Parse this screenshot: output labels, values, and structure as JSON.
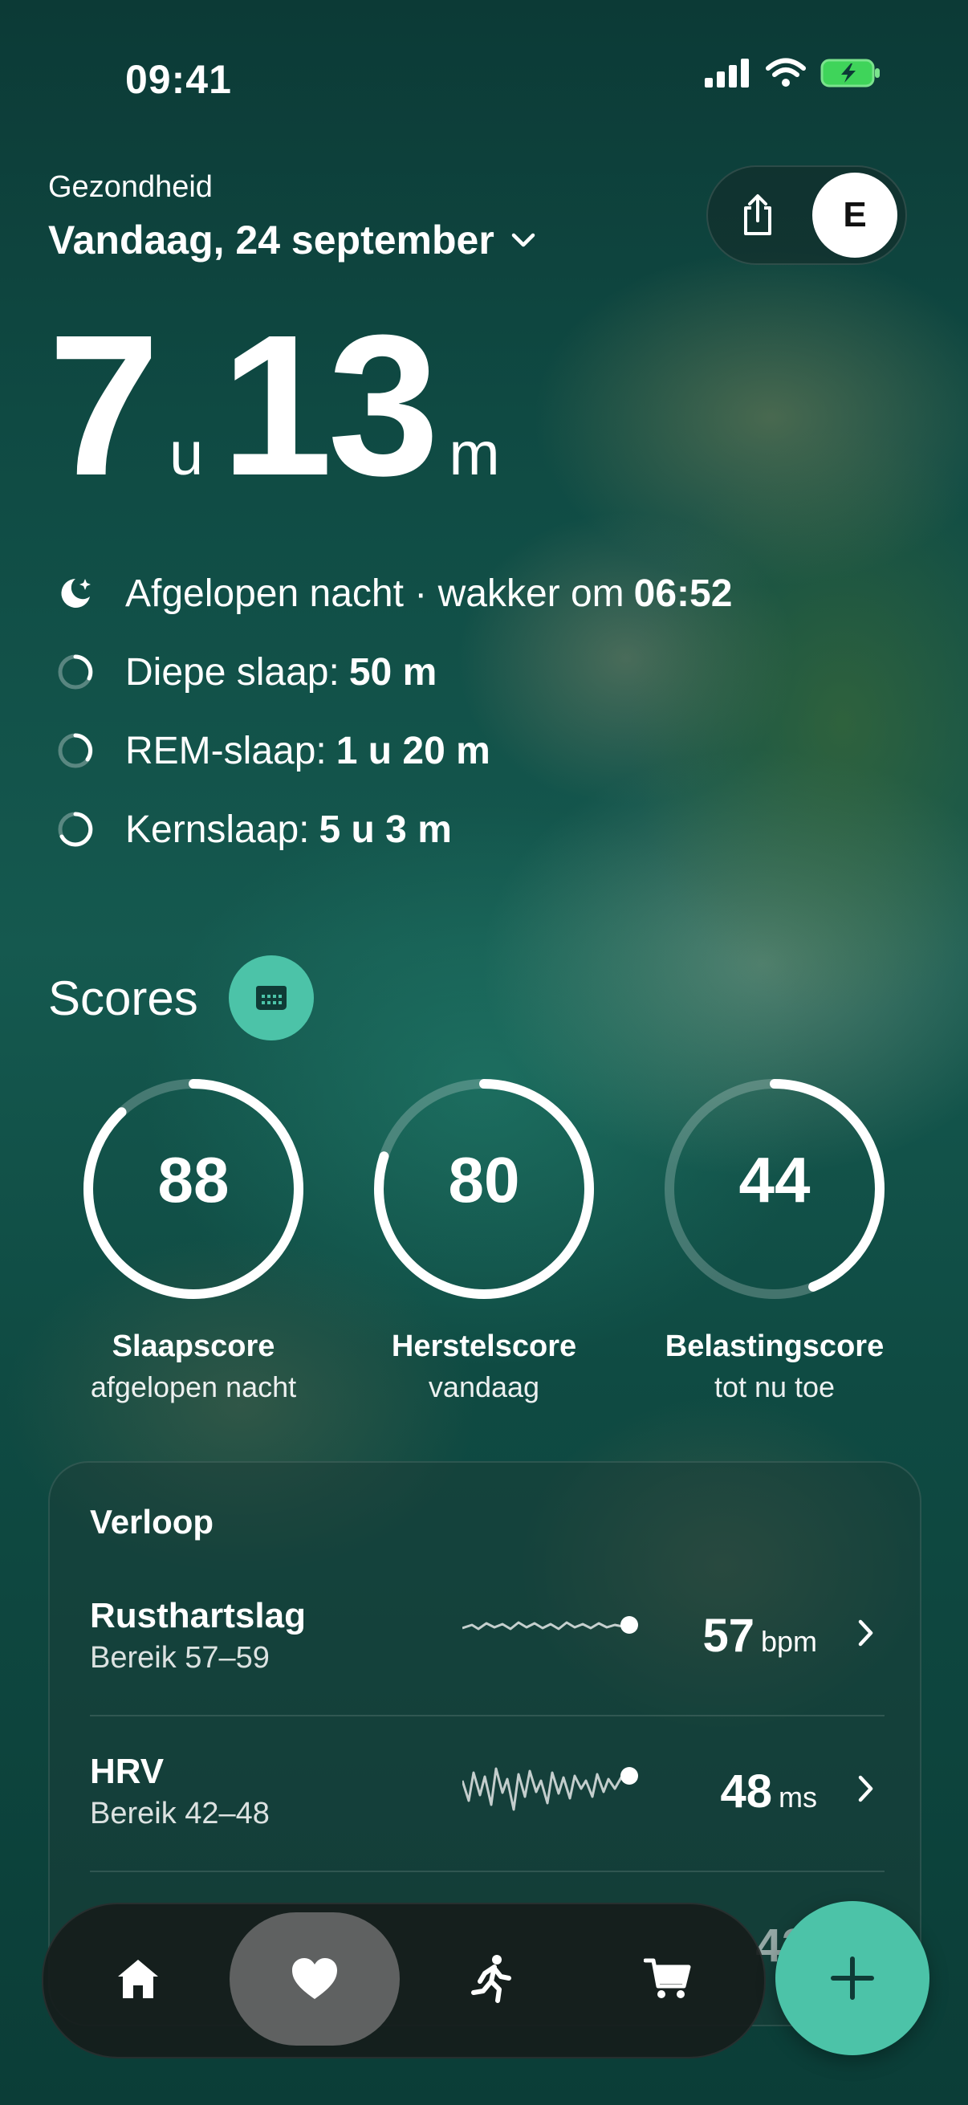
{
  "status_bar": {
    "time": "09:41"
  },
  "header": {
    "app_label": "Gezondheid",
    "date": "Vandaag, 24 september",
    "avatar_initial": "E"
  },
  "sleep_total": {
    "hours": "7",
    "hours_unit": "u",
    "minutes": "13",
    "minutes_unit": "m"
  },
  "metrics": [
    {
      "label": "Afgelopen nacht · wakker om",
      "value": "06:52"
    },
    {
      "label": "Diepe slaap:",
      "value": "50 m"
    },
    {
      "label": "REM-slaap:",
      "value": "1 u 20 m"
    },
    {
      "label": "Kernslaap:",
      "value": "5 u 3 m"
    }
  ],
  "scores": {
    "title": "Scores",
    "items": [
      {
        "value": "88",
        "label": "Slaapscore",
        "sub": "afgelopen nacht",
        "fraction": 0.88
      },
      {
        "value": "80",
        "label": "Herstelscore",
        "sub": "vandaag",
        "fraction": 0.8
      },
      {
        "value": "44",
        "label": "Belastingscore",
        "sub": "tot nu toe",
        "fraction": 0.44
      }
    ]
  },
  "trends": {
    "title": "Verloop",
    "rows": [
      {
        "name": "Rusthartslag",
        "range": "Bereik 57–59",
        "value": "57",
        "unit": "bpm"
      },
      {
        "name": "HRV",
        "range": "Bereik 42–48",
        "value": "48",
        "unit": "ms"
      }
    ],
    "partial_value": "42"
  },
  "colors": {
    "accent": "#4cc3a8"
  },
  "tabbar": {
    "tabs": [
      {
        "icon": "home-icon"
      },
      {
        "icon": "heart-icon",
        "active": true
      },
      {
        "icon": "running-icon"
      },
      {
        "icon": "cart-icon"
      }
    ],
    "fab_icon": "plus-icon"
  }
}
